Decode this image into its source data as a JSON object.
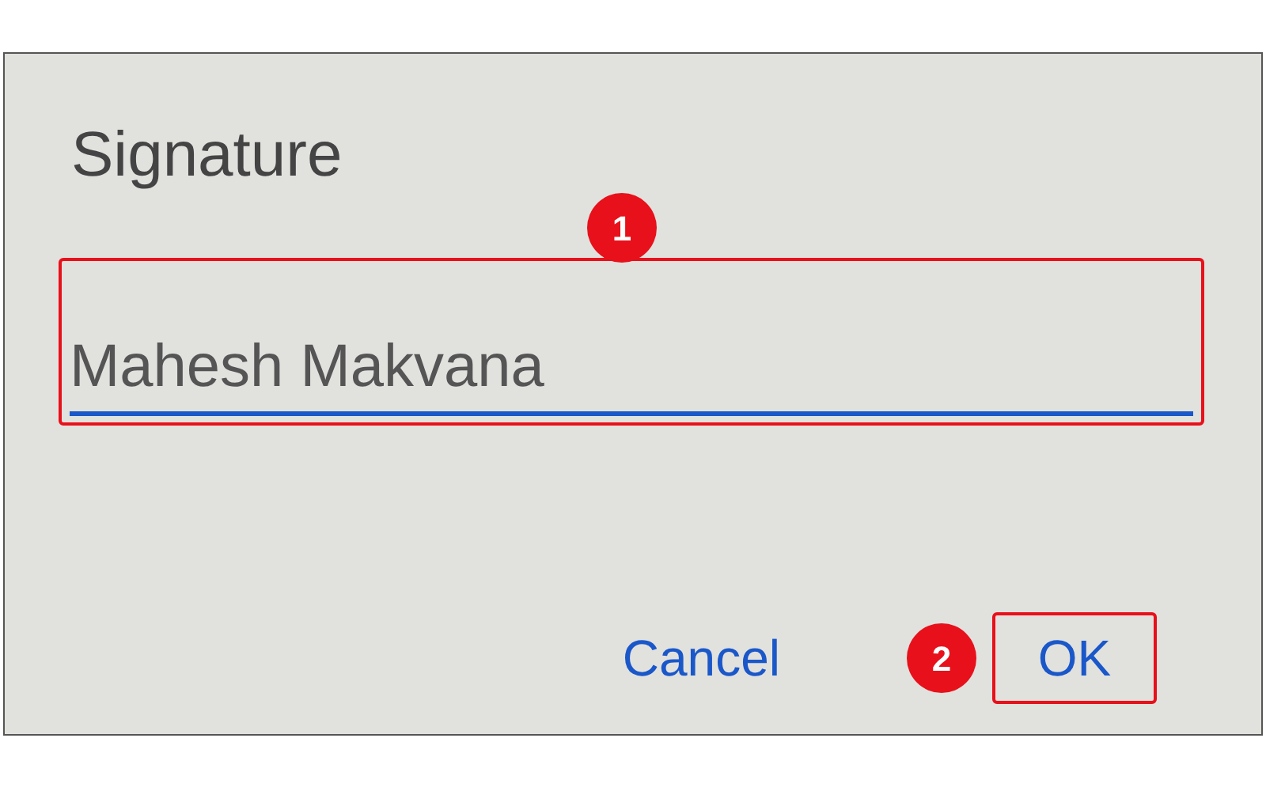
{
  "dialog": {
    "title": "Signature",
    "field": {
      "value": "Mahesh Makvana",
      "highlighted": true,
      "step": "1"
    },
    "buttons": [
      {
        "label": "Cancel",
        "highlighted": false
      },
      {
        "label": "OK",
        "highlighted": true,
        "step": "2"
      }
    ]
  }
}
